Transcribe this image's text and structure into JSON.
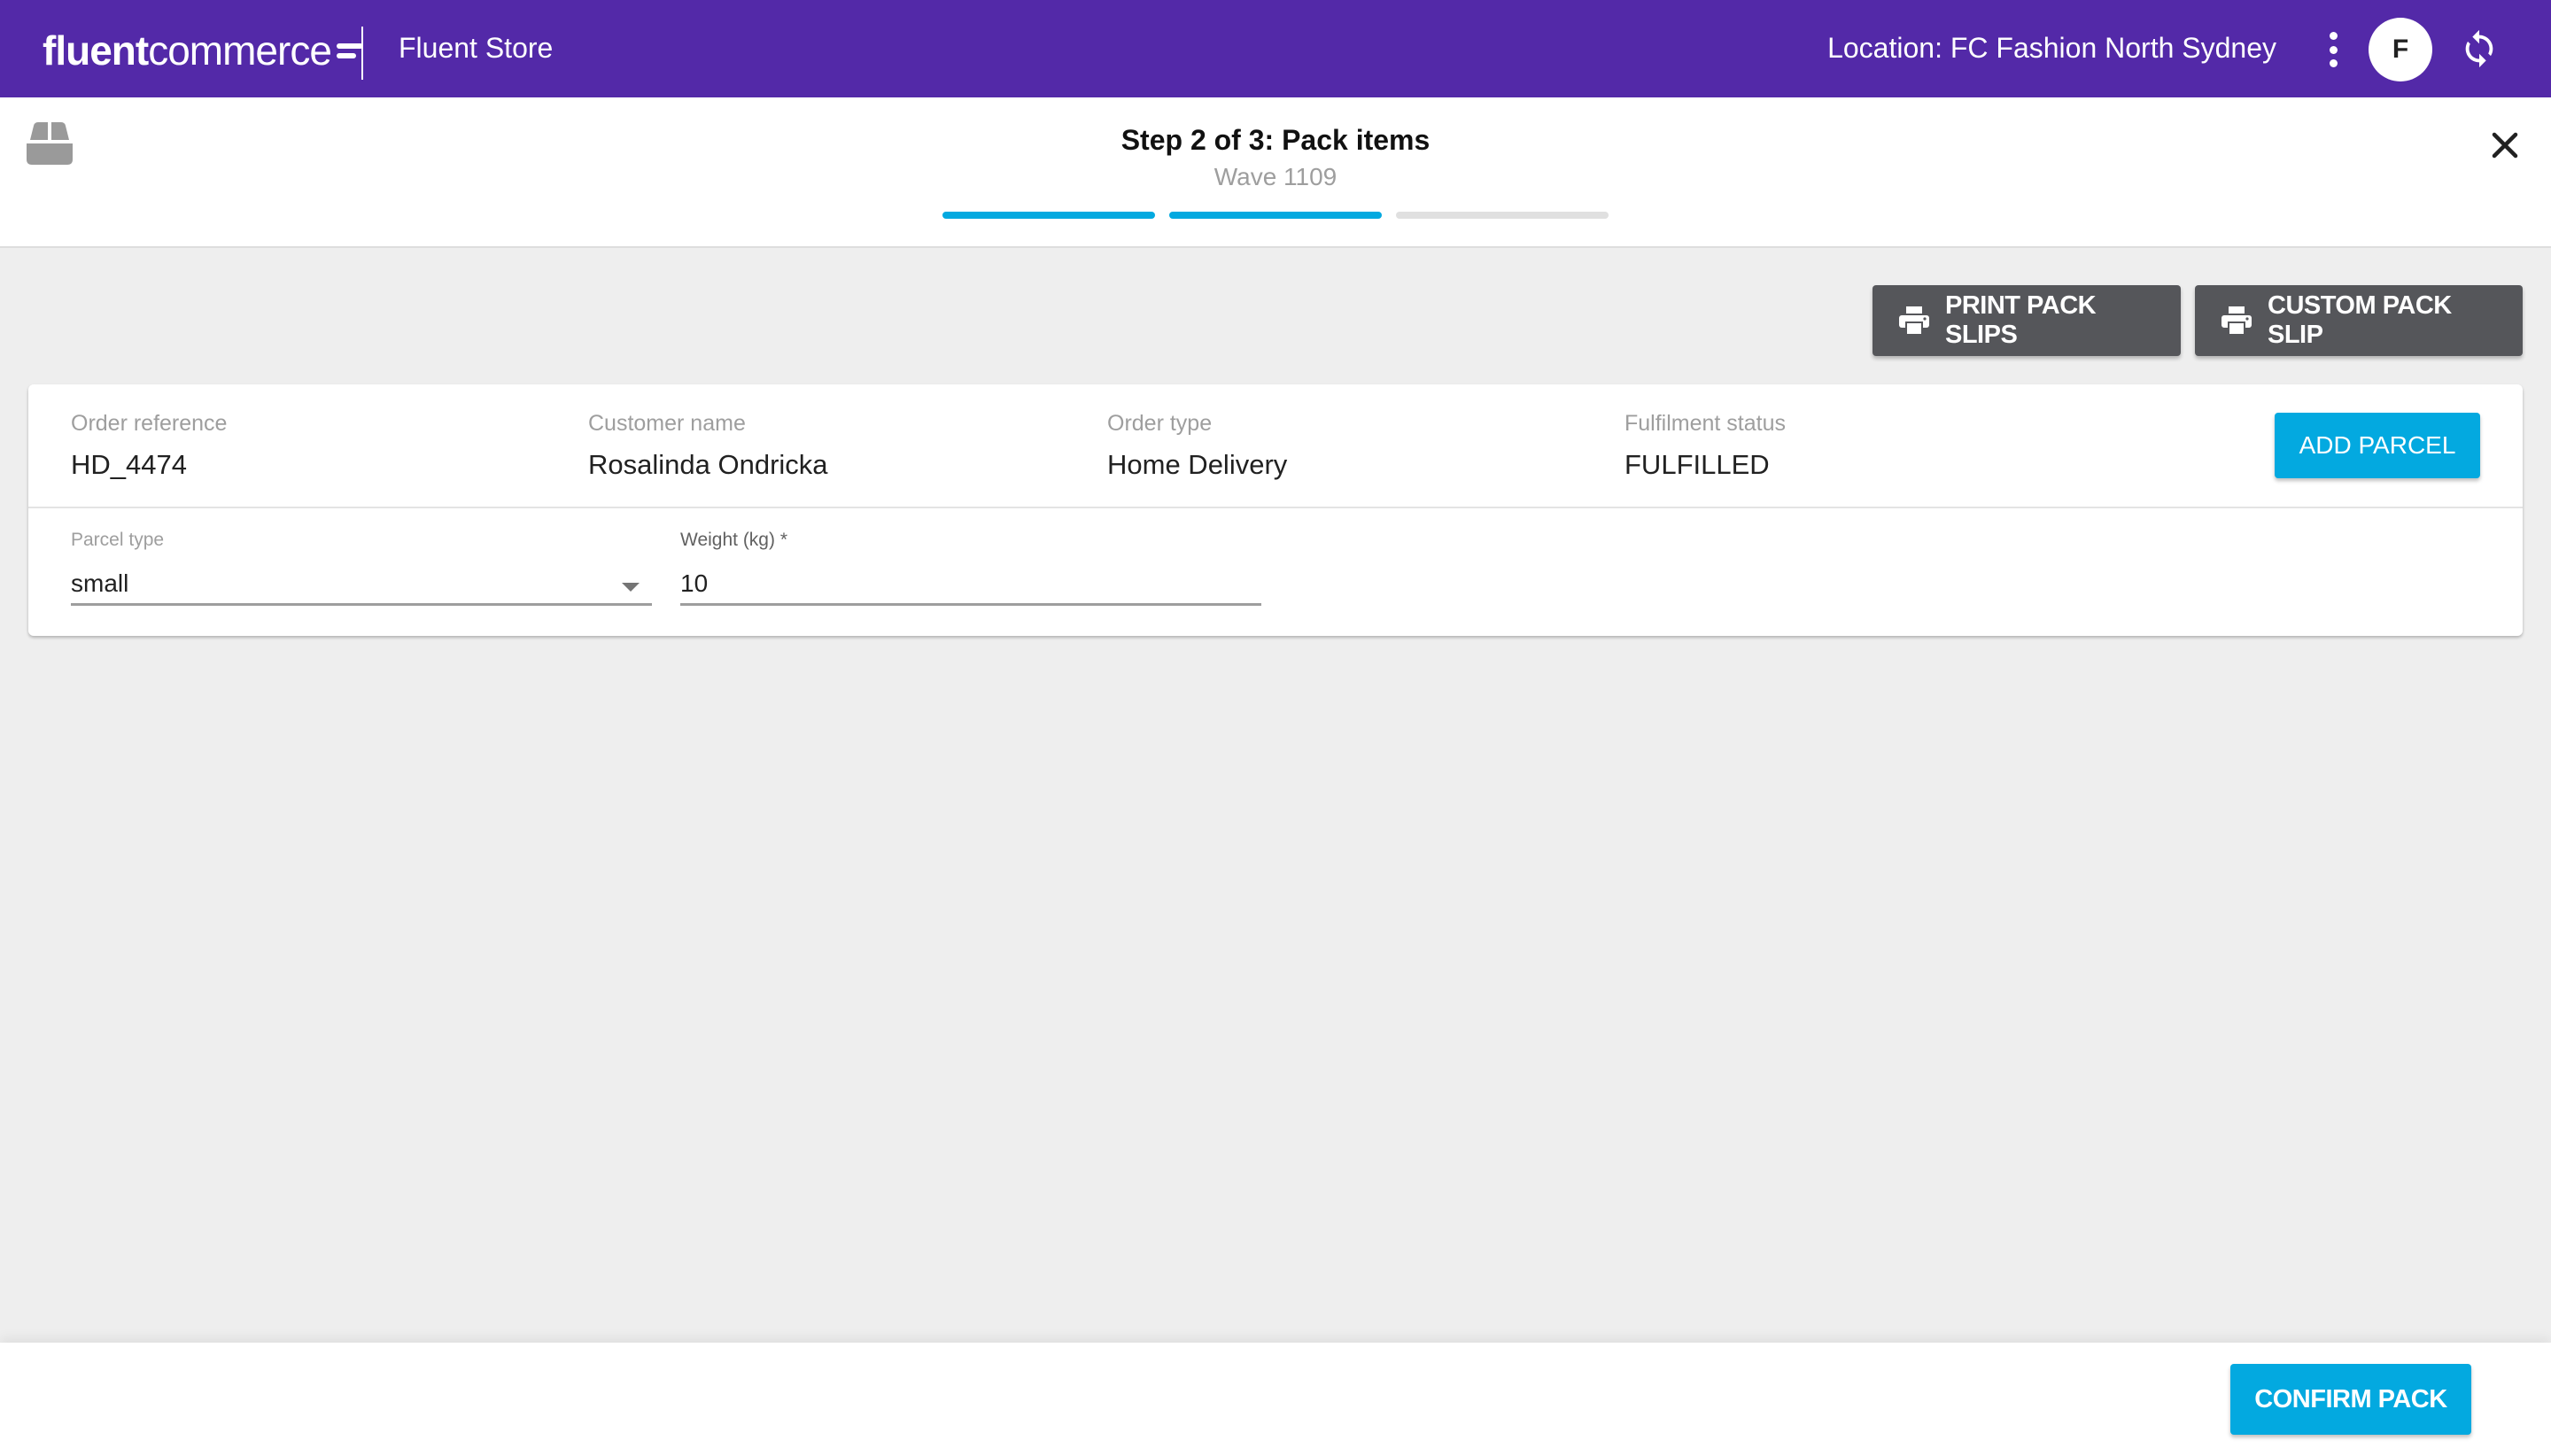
{
  "appbar": {
    "logo_bold": "fluent",
    "logo_light": "commerce",
    "app_name": "Fluent Store",
    "location": "Location: FC Fashion North Sydney",
    "avatar_initial": "F",
    "icons": {
      "menu": "more-vert-icon",
      "refresh": "sync-icon"
    },
    "background_color": "#5329a8"
  },
  "step": {
    "title": "Step 2 of 3: Pack items",
    "subtitle": "Wave 1109",
    "current": 2,
    "total": 3,
    "accent_color": "#03a9e0"
  },
  "actions": {
    "print_pack_slips": "PRINT PACK SLIPS",
    "custom_pack_slip": "CUSTOM PACK SLIP"
  },
  "order": {
    "fields": [
      {
        "label": "Order reference",
        "value": "HD_4474"
      },
      {
        "label": "Customer name",
        "value": "Rosalinda Ondricka"
      },
      {
        "label": "Order type",
        "value": "Home Delivery"
      },
      {
        "label": "Fulfilment status",
        "value": "FULFILLED"
      }
    ],
    "add_parcel_label": "ADD PARCEL"
  },
  "parcel": {
    "type_label": "Parcel type",
    "type_value": "small",
    "weight_label": "Weight (kg) *",
    "weight_value": "10"
  },
  "footer": {
    "confirm_label": "CONFIRM PACK"
  }
}
